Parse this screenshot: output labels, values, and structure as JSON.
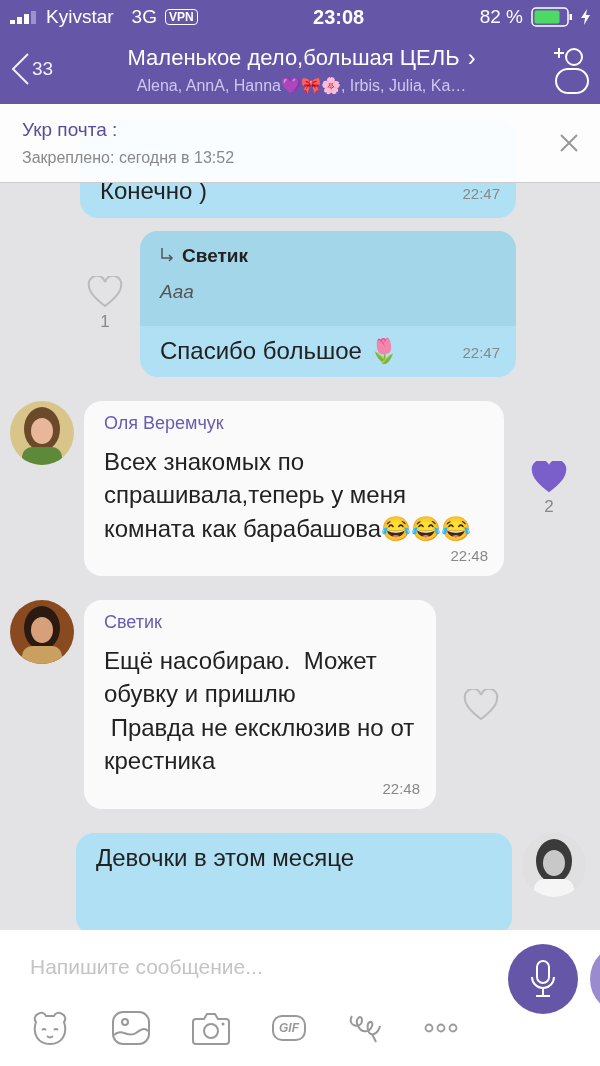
{
  "status_bar": {
    "carrier": "Kyivstar",
    "network": "3G",
    "vpn": "VPN",
    "time": "23:08",
    "battery": "82 %"
  },
  "header": {
    "back_count": "33",
    "title": "Маленькое дело,большая ЦЕЛЬ",
    "chevron": "›",
    "members": "Alena, AnnA, Hanna💜🎀🌸, Irbis, Julia, Ka…"
  },
  "pinned": {
    "title": "Укр почта :",
    "subtitle": "Закреплено: сегодня в 13:52"
  },
  "messages": [
    {
      "kind": "outgoing",
      "text": "Конечно )",
      "time": "22:47"
    },
    {
      "kind": "outgoing",
      "reply_author": "Светик",
      "reply_text": "Ааа",
      "text": "Спасибо большое 🌷",
      "time": "22:47",
      "liked": false,
      "like_count": "1"
    },
    {
      "kind": "incoming",
      "author": "Оля Веремчук",
      "text": "Всех знакомых по спрашивала,теперь у меня комната как барабашова😂😂😂",
      "time": "22:48",
      "liked": true,
      "like_count": "2",
      "has_avatar": true
    },
    {
      "kind": "incoming",
      "author": "Светик",
      "text": "Ещё насобираю.  Может обувку и пришлю\n Правда не ексклюзив но от крестника",
      "time": "22:48",
      "liked": false,
      "has_avatar": true
    },
    {
      "kind": "outgoing",
      "text": "Девочки в этом месяце",
      "has_avatar": true
    }
  ],
  "composer": {
    "placeholder": "Напишите сообщение...",
    "gif": "GIF"
  }
}
